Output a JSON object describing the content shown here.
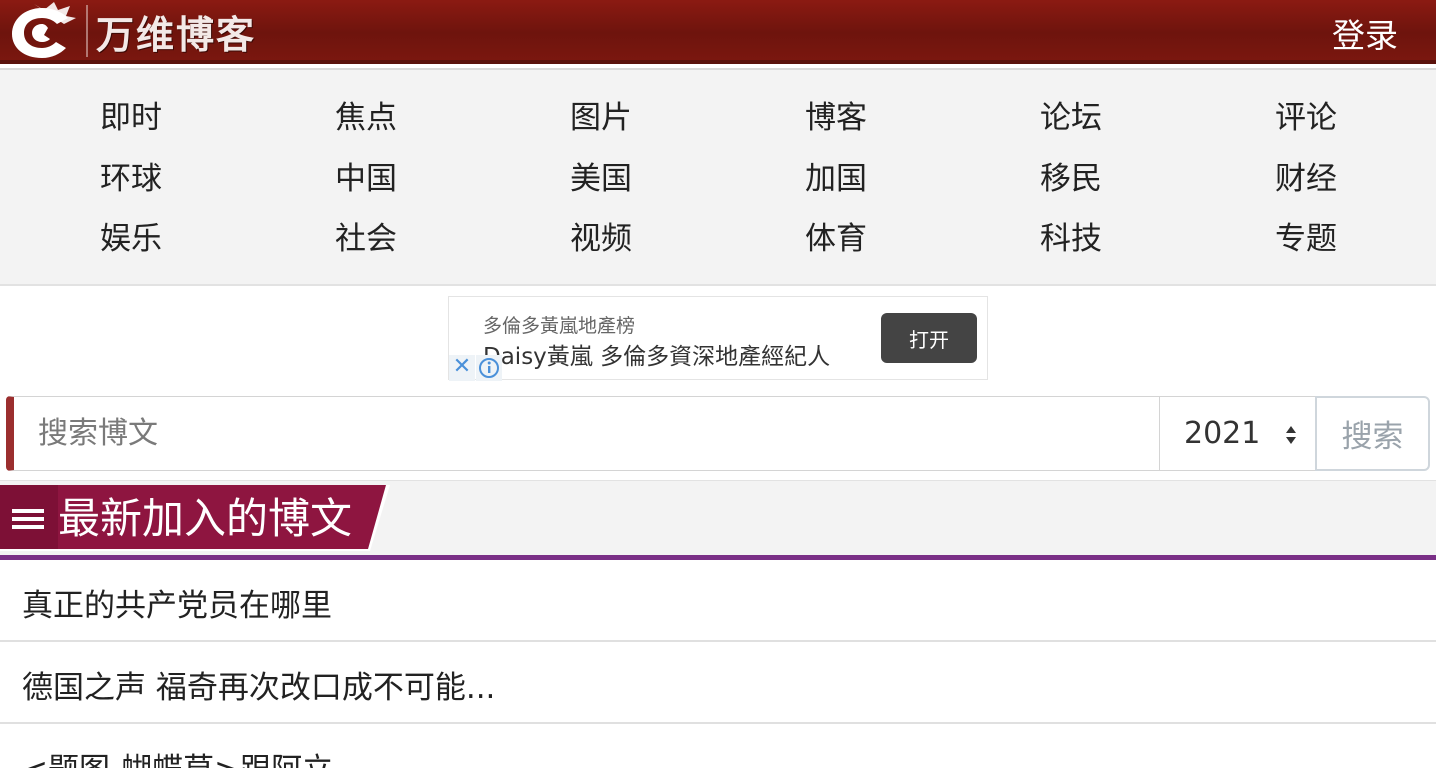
{
  "header": {
    "site_name": "万维博客",
    "login_label": "登录",
    "bg_color": "#7a170f"
  },
  "nav": {
    "rows": [
      [
        "即时",
        "焦点",
        "图片",
        "博客",
        "论坛",
        "评论"
      ],
      [
        "环球",
        "中国",
        "美国",
        "加国",
        "移民",
        "财经"
      ],
      [
        "娱乐",
        "社会",
        "视频",
        "体育",
        "科技",
        "专题"
      ]
    ]
  },
  "ad": {
    "subtitle": "多倫多黃嵐地產榜",
    "title": "Daisy黃嵐 多倫多資深地產經紀人",
    "button": "打开",
    "close_icon": "close-icon",
    "info_icon": "info-icon"
  },
  "search": {
    "placeholder": "搜索博文",
    "year": "2021",
    "button": "搜索"
  },
  "section": {
    "title": "最新加入的博文",
    "accent_color": "#8e1540",
    "line_color": "#7a2f86"
  },
  "posts": [
    "真正的共产党员在哪里",
    "德国之声 福奇再次改口成不可能...",
    "<题图-蝴蝶草>跟阿立"
  ]
}
